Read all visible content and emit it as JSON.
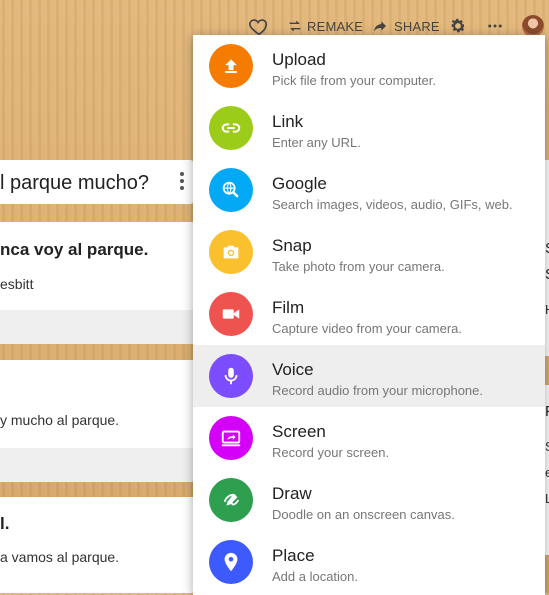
{
  "toolbar": {
    "remake_label": "REMAKE",
    "share_label": "SHARE"
  },
  "question": {
    "title": "l parque mucho?"
  },
  "answers": [
    {
      "line1": "nca voy al parque.",
      "line2": "esbitt"
    },
    {
      "line1": "y mucho al parque."
    },
    {
      "line1": "l.",
      "line2": "a vamos al parque."
    }
  ],
  "right_column": {
    "chars": [
      "S",
      "S",
      "H",
      "F",
      "S",
      "e",
      "L"
    ]
  },
  "menu": {
    "items": [
      {
        "title": "Upload",
        "subtitle": "Pick file from your computer.",
        "color": "#f57c00",
        "icon": "upload-icon"
      },
      {
        "title": "Link",
        "subtitle": "Enter any URL.",
        "color": "#9ccc1a",
        "icon": "link-icon"
      },
      {
        "title": "Google",
        "subtitle": "Search images, videos, audio, GIFs, web.",
        "color": "#03a9f4",
        "icon": "search-globe-icon"
      },
      {
        "title": "Snap",
        "subtitle": "Take photo from your camera.",
        "color": "#fbc02d",
        "icon": "camera-icon"
      },
      {
        "title": "Film",
        "subtitle": "Capture video from your camera.",
        "color": "#ef5350",
        "icon": "video-camera-icon"
      },
      {
        "title": "Voice",
        "subtitle": "Record audio from your microphone.",
        "color": "#7c4dff",
        "icon": "microphone-icon"
      },
      {
        "title": "Screen",
        "subtitle": "Record your screen.",
        "color": "#d500f9",
        "icon": "screen-share-icon"
      },
      {
        "title": "Draw",
        "subtitle": "Doodle on an onscreen canvas.",
        "color": "#2e9e4f",
        "icon": "draw-icon"
      },
      {
        "title": "Place",
        "subtitle": "Add a location.",
        "color": "#3d5afe",
        "icon": "location-pin-icon"
      }
    ]
  }
}
